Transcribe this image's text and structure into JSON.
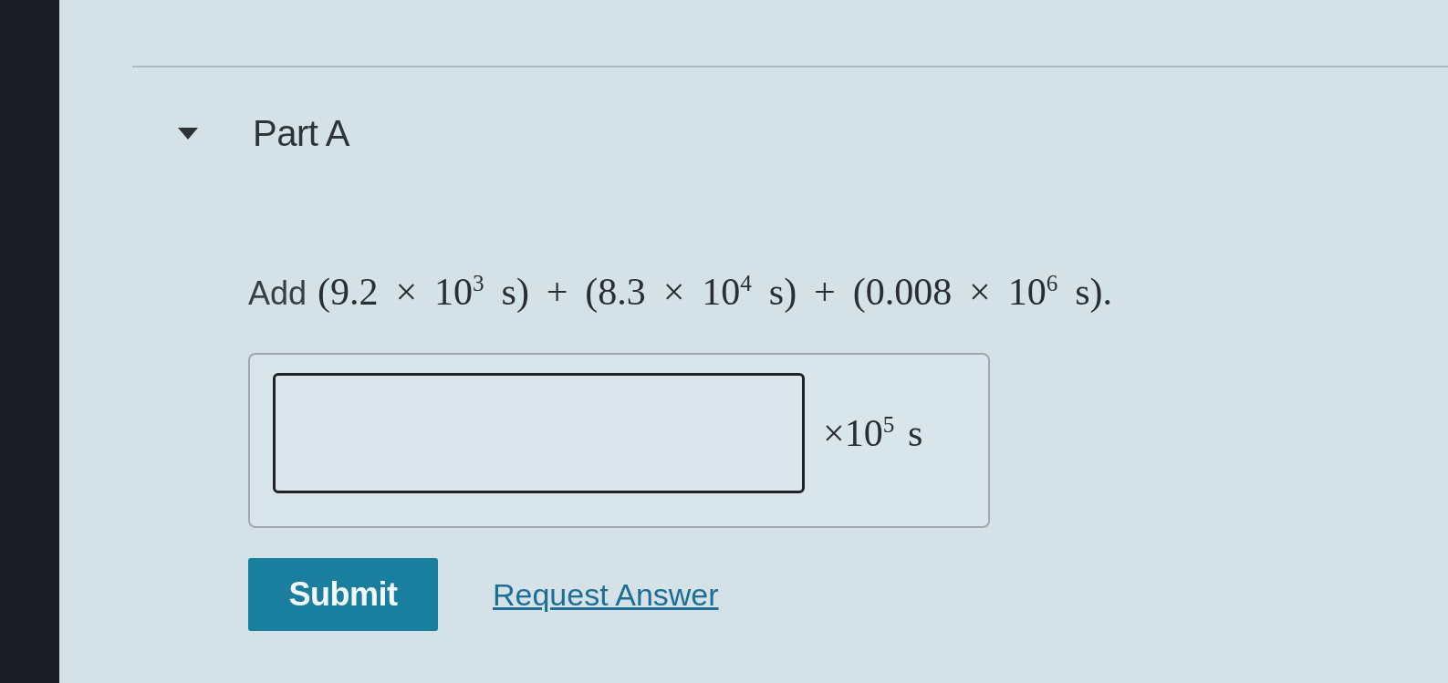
{
  "part": {
    "title": "Part A",
    "expanded": true
  },
  "question": {
    "lead": "Add",
    "expression": "(9.2 × 10$^{3}$ s) + (8.3 × 10$^{4}$ s) + (0.008 × 10$^{6}$ s)."
  },
  "answer": {
    "unit": "×10$^{5}$ s"
  },
  "actions": [
    {
      "kind": "button",
      "label": "Submit"
    },
    {
      "kind": "link",
      "label": "Request Answer"
    }
  ]
}
